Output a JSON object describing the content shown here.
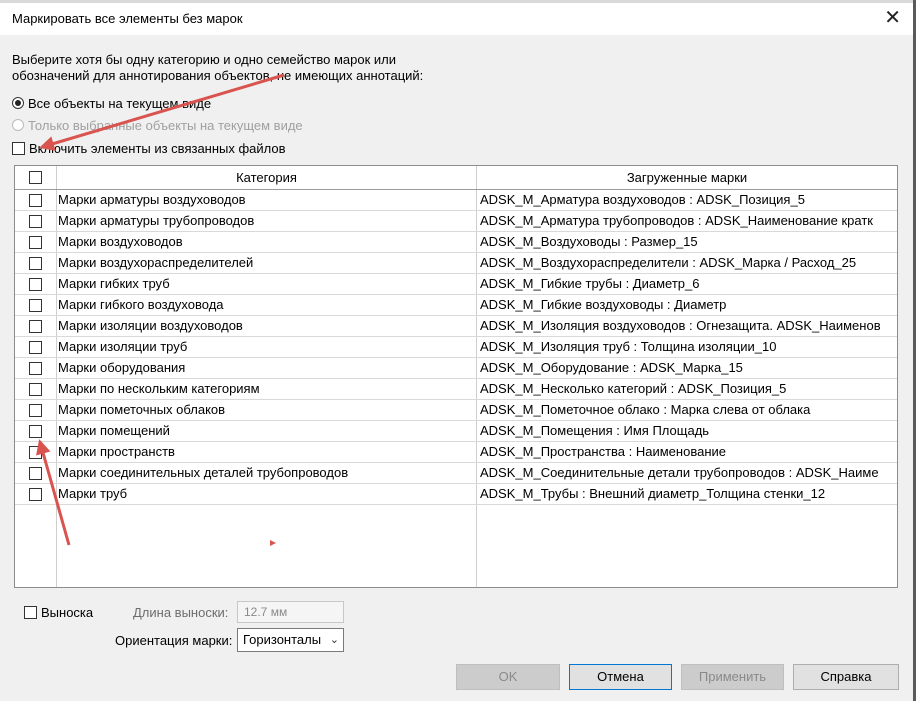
{
  "window": {
    "title": "Маркировать все элементы без марок"
  },
  "instruction": "Выберите хотя бы одну категорию и одно семейство марок или обозначений для аннотирования объектов, не имеющих аннотаций:",
  "options": {
    "all_in_view": "Все объекты на текущем виде",
    "only_selected": "Только выбранные объекты на текущем виде",
    "include_linked": "Включить элементы из связанных файлов"
  },
  "table": {
    "headers": [
      "Категория",
      "Загруженные марки"
    ],
    "rows": [
      {
        "category": "Марки арматуры воздуховодов",
        "tag": "ADSK_M_Арматура воздуховодов : ADSK_Позиция_5"
      },
      {
        "category": "Марки арматуры трубопроводов",
        "tag": "ADSK_M_Арматура трубопроводов : ADSK_Наименование кратк"
      },
      {
        "category": "Марки воздуховодов",
        "tag": "ADSK_M_Воздуховоды : Размер_15"
      },
      {
        "category": "Марки воздухораспределителей",
        "tag": "ADSK_M_Воздухораспределители : ADSK_Марка / Расход_25"
      },
      {
        "category": "Марки гибких труб",
        "tag": "ADSK_M_Гибкие трубы : Диаметр_6"
      },
      {
        "category": "Марки гибкого воздуховода",
        "tag": "ADSK_M_Гибкие воздуховоды : Диаметр"
      },
      {
        "category": "Марки изоляции воздуховодов",
        "tag": "ADSK_M_Изоляция воздуховодов : Огнезащита. ADSK_Наименов"
      },
      {
        "category": "Марки изоляции труб",
        "tag": "ADSK_M_Изоляция труб : Толщина изоляции_10"
      },
      {
        "category": "Марки оборудования",
        "tag": "ADSK_M_Оборудование : ADSK_Марка_15"
      },
      {
        "category": "Марки по нескольким категориям",
        "tag": "ADSK_M_Несколько категорий : ADSK_Позиция_5"
      },
      {
        "category": "Марки пометочных облаков",
        "tag": "ADSK_M_Пометочное облако : Марка слева от облака"
      },
      {
        "category": "Марки помещений",
        "tag": "ADSK_M_Помещения : Имя Площадь"
      },
      {
        "category": "Марки пространств",
        "tag": "ADSK_M_Пространства : Наименование"
      },
      {
        "category": "Марки соединительных деталей трубопроводов",
        "tag": "ADSK_M_Соединительные детали трубопроводов : ADSK_Наиме"
      },
      {
        "category": "Марки труб",
        "tag": "ADSK_M_Трубы : Внешний диаметр_Толщина стенки_12"
      }
    ]
  },
  "leader": {
    "checkbox_label": "Выноска",
    "length_label": "Длина выноски:",
    "length_value": "12.7 мм",
    "orientation_label": "Ориентация марки:",
    "orientation_value": "Горизонталы"
  },
  "buttons": {
    "ok": "OK",
    "cancel": "Отмена",
    "apply": "Применить",
    "help": "Справка"
  },
  "colors": {
    "annotation_arrow": "#d9534f"
  }
}
